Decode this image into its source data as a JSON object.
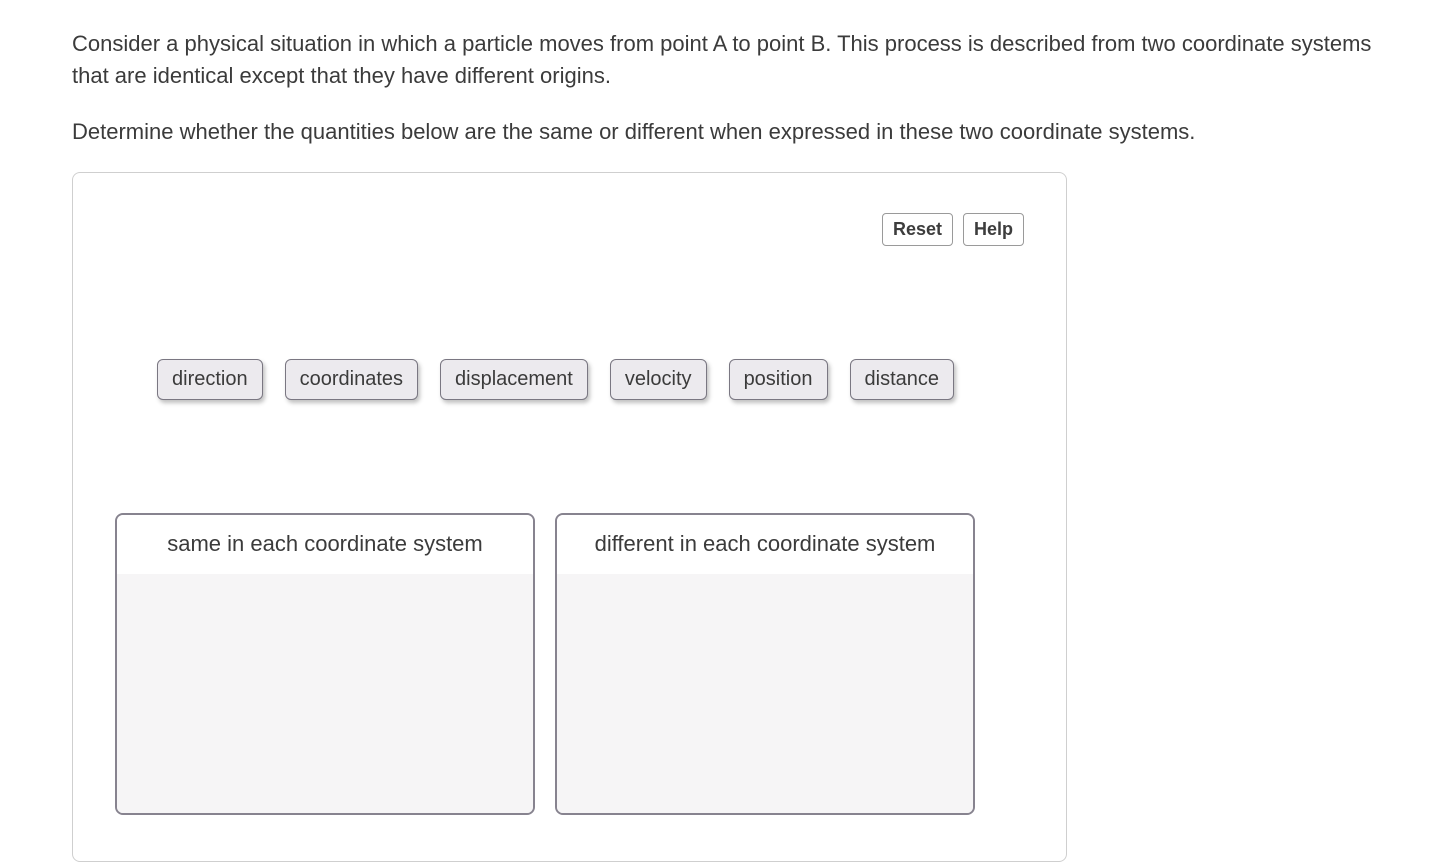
{
  "question": {
    "para1": "Consider a physical situation in which a particle moves from point A to point B. This process is described from two coordinate systems that are identical except that they have different origins.",
    "para2": "Determine whether the quantities below are the same or different when expressed in these two coordinate systems."
  },
  "buttons": {
    "reset": "Reset",
    "help": "Help"
  },
  "chips": [
    "direction",
    "coordinates",
    "displacement",
    "velocity",
    "position",
    "distance"
  ],
  "bins": {
    "same": "same in each coordinate system",
    "different": "different in each coordinate system"
  }
}
